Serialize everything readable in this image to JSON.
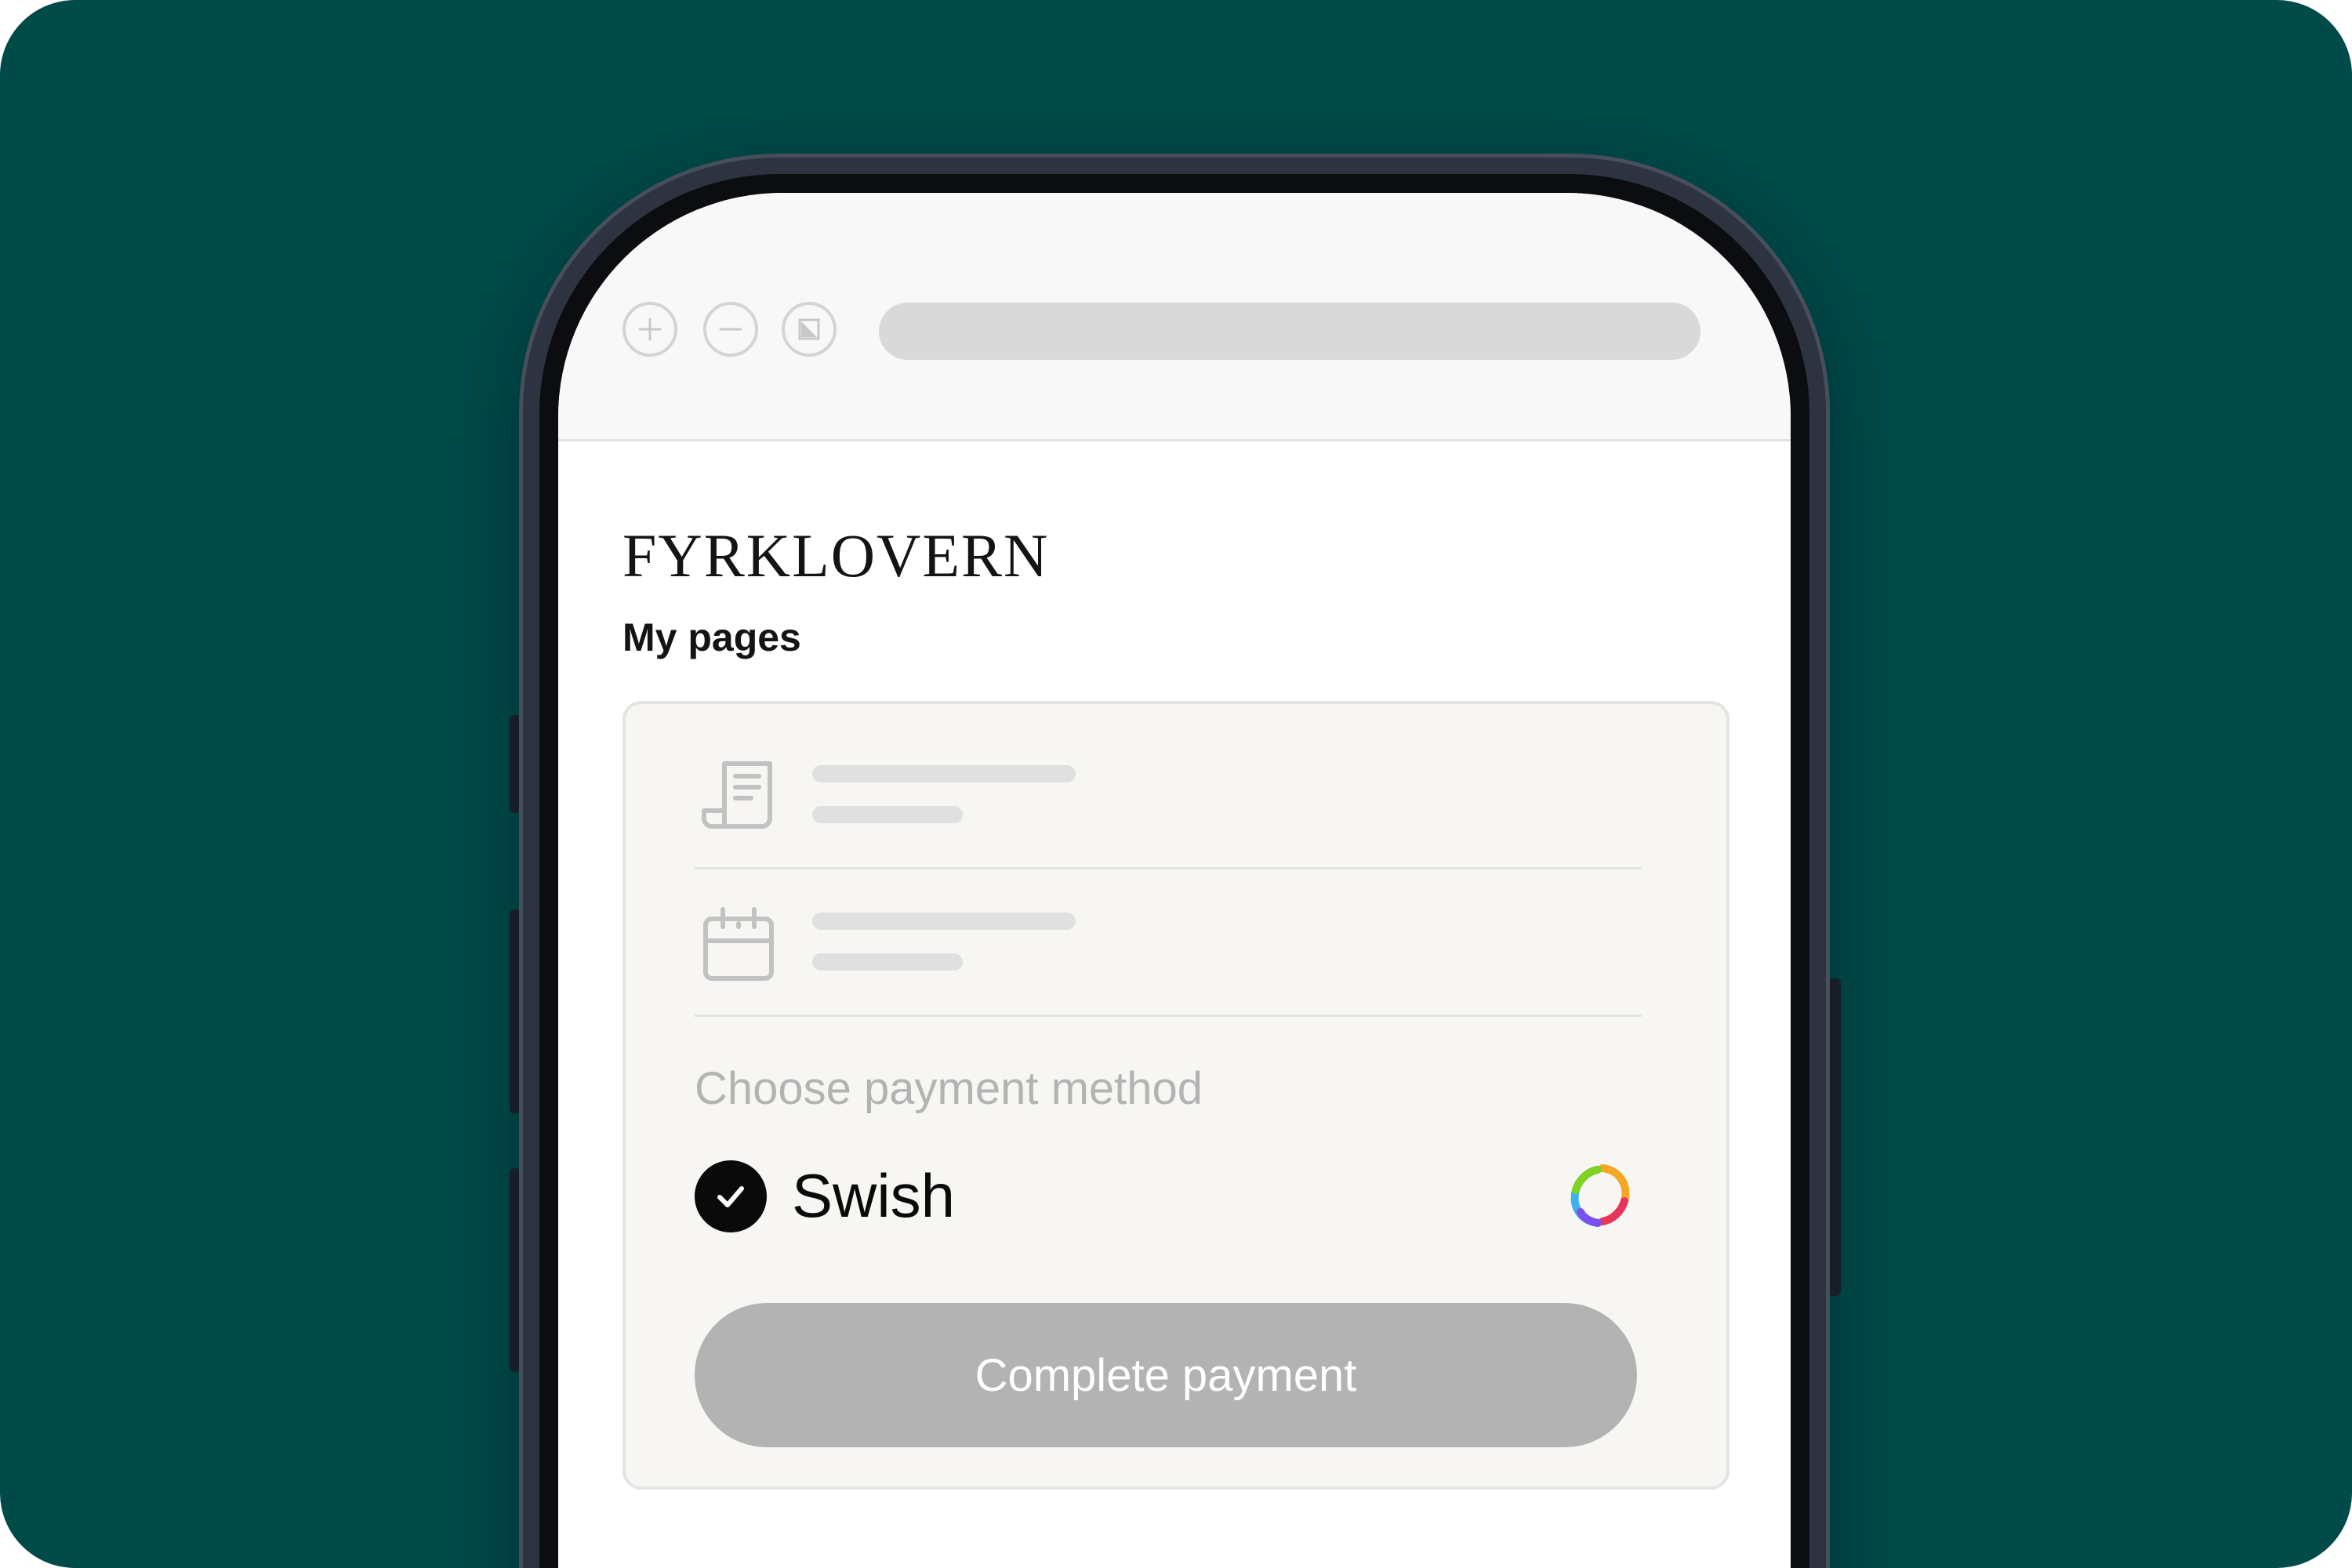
{
  "colors": {
    "background": "#004a4a",
    "card_background": "#f7f6f3",
    "button_disabled": "#b3b3b3",
    "text_primary": "#0a0a0a",
    "text_muted": "#b3b3b3"
  },
  "browser": {
    "nav_icons": [
      "zoom-in-icon",
      "zoom-out-icon",
      "fit-screen-icon"
    ]
  },
  "brand": {
    "logo_text": "FYRKLOVERN"
  },
  "page": {
    "title": "My pages"
  },
  "card": {
    "items": [
      {
        "icon": "receipt-icon"
      },
      {
        "icon": "calendar-icon"
      }
    ],
    "payment": {
      "label": "Choose payment method",
      "selected_method": "Swish",
      "method_icon": "swish-logo-icon",
      "button_label": "Complete payment"
    }
  }
}
